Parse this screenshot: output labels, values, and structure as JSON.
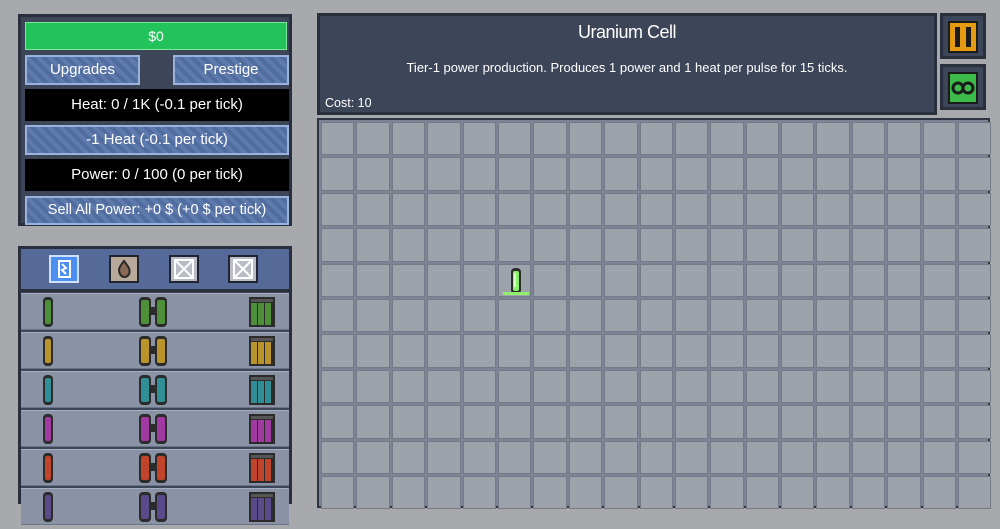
{
  "money": "$0",
  "buttons": {
    "upgrades": "Upgrades",
    "prestige": "Prestige",
    "vent": "-1 Heat (-0.1 per tick)",
    "sell": "Sell All Power: +0 $ (+0 $ per tick)"
  },
  "stats": {
    "heat": "Heat: 0 / 1K (-0.1 per tick)",
    "power": "Power: 0 / 100 (0 per tick)"
  },
  "tabs": [
    {
      "name": "power-tab-icon",
      "selected": true
    },
    {
      "name": "heat-tab-icon",
      "selected": false
    },
    {
      "name": "locked-tab-icon",
      "selected": false
    },
    {
      "name": "locked-tab-icon",
      "selected": false
    }
  ],
  "parts": {
    "rows": [
      {
        "color": "#4e8f3a",
        "kinds": [
          "single-cell",
          "double-cell",
          "quad-cell"
        ]
      },
      {
        "color": "#b8942a",
        "kinds": [
          "single-cell",
          "double-cell",
          "quad-cell"
        ]
      },
      {
        "color": "#2f8f94",
        "kinds": [
          "single-cell",
          "double-cell",
          "quad-cell"
        ]
      },
      {
        "color": "#a03aa0",
        "kinds": [
          "single-cell",
          "double-cell",
          "quad-cell"
        ]
      },
      {
        "color": "#c0442c",
        "kinds": [
          "single-cell",
          "double-cell",
          "quad-cell"
        ]
      },
      {
        "color": "#5a4a8a",
        "kinds": [
          "single-cell",
          "double-cell",
          "quad-cell"
        ]
      }
    ]
  },
  "info": {
    "title": "Uranium Cell",
    "description": "Tier-1 power production. Produces 1 power and 1 heat per pulse for 15 ticks.",
    "cost": "Cost: 10"
  },
  "controls": {
    "pause": "pause-icon",
    "auto": "infinity-icon"
  },
  "reactor": {
    "columns": 19,
    "rows": 11,
    "placed": [
      {
        "row": 4,
        "col": 5,
        "part": "uranium-cell"
      }
    ]
  },
  "colors": {
    "money": "#22c35a",
    "panel": "#3d4558",
    "button": "#5573a8",
    "tile": "#9ea2aa"
  }
}
